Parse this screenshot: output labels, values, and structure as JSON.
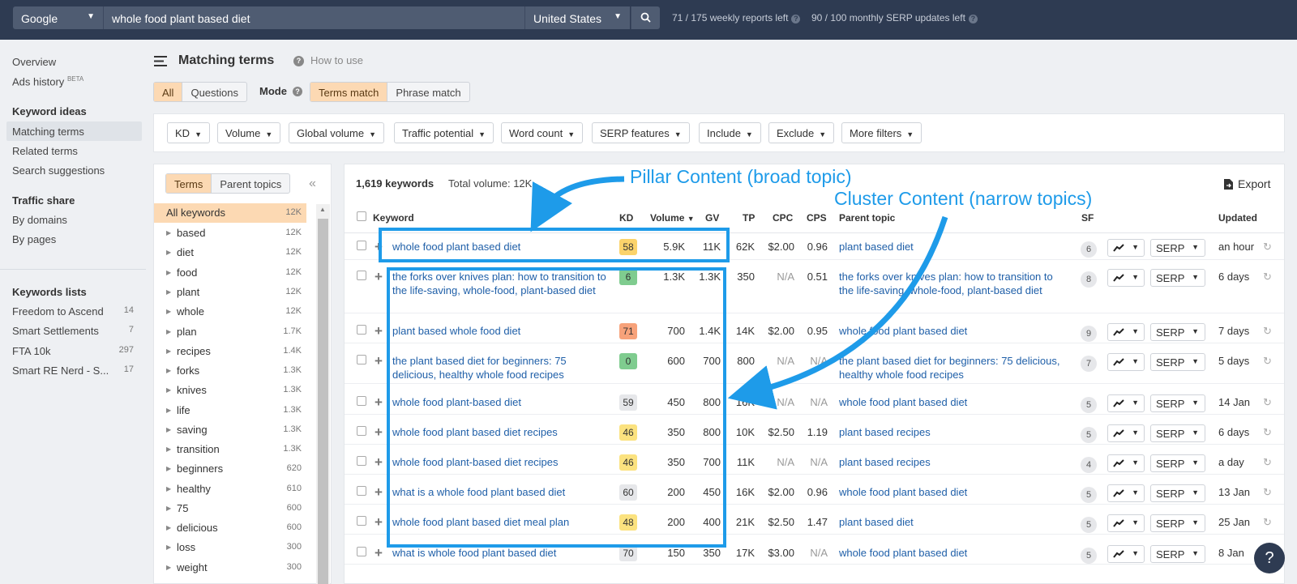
{
  "topbar": {
    "engine": "Google",
    "query": "whole food plant based diet",
    "country": "United States",
    "weekly": "71 / 175 weekly reports left",
    "monthly": "90 / 100 monthly SERP updates left"
  },
  "nav": {
    "overview": "Overview",
    "ads_history": "Ads history",
    "beta": "BETA",
    "keyword_ideas": "Keyword ideas",
    "matching_terms": "Matching terms",
    "related_terms": "Related terms",
    "search_suggestions": "Search suggestions",
    "traffic_share": "Traffic share",
    "by_domains": "By domains",
    "by_pages": "By pages",
    "lists_head": "Keywords lists",
    "lists": [
      {
        "name": "Freedom to Ascend",
        "count": "14"
      },
      {
        "name": "Smart Settlements",
        "count": "7"
      },
      {
        "name": "FTA 10k",
        "count": "297"
      },
      {
        "name": "Smart RE Nerd - S...",
        "count": "17"
      }
    ]
  },
  "header": {
    "title": "Matching terms",
    "how_to": "How to use",
    "all": "All",
    "questions": "Questions",
    "mode": "Mode",
    "terms_match": "Terms match",
    "phrase_match": "Phrase match"
  },
  "filters": [
    "KD",
    "Volume",
    "Global volume",
    "Traffic potential",
    "Word count",
    "SERP features",
    "Include",
    "Exclude",
    "More filters"
  ],
  "terms_panel": {
    "terms_tab": "Terms",
    "parent_tab": "Parent topics",
    "all_label": "All keywords",
    "all_count": "12K",
    "items": [
      {
        "label": "based",
        "count": "12K"
      },
      {
        "label": "diet",
        "count": "12K"
      },
      {
        "label": "food",
        "count": "12K"
      },
      {
        "label": "plant",
        "count": "12K"
      },
      {
        "label": "whole",
        "count": "12K"
      },
      {
        "label": "plan",
        "count": "1.7K"
      },
      {
        "label": "recipes",
        "count": "1.4K"
      },
      {
        "label": "forks",
        "count": "1.3K"
      },
      {
        "label": "knives",
        "count": "1.3K"
      },
      {
        "label": "life",
        "count": "1.3K"
      },
      {
        "label": "saving",
        "count": "1.3K"
      },
      {
        "label": "transition",
        "count": "1.3K"
      },
      {
        "label": "beginners",
        "count": "620"
      },
      {
        "label": "healthy",
        "count": "610"
      },
      {
        "label": "75",
        "count": "600"
      },
      {
        "label": "delicious",
        "count": "600"
      },
      {
        "label": "loss",
        "count": "300"
      },
      {
        "label": "weight",
        "count": "300"
      }
    ]
  },
  "results": {
    "count": "1,619 keywords",
    "total_volume": "Total volume: 12K",
    "export": "Export",
    "columns": {
      "keyword": "Keyword",
      "kd": "KD",
      "volume": "Volume",
      "gv": "GV",
      "tp": "TP",
      "cpc": "CPC",
      "cps": "CPS",
      "parent": "Parent topic",
      "sf": "SF",
      "updated": "Updated"
    },
    "serp_label": "SERP",
    "rows": [
      {
        "keyword": "whole food plant based diet",
        "kd": "58",
        "kd_color": "#fbd36b",
        "volume": "5.9K",
        "gv": "11K",
        "tp": "62K",
        "cpc": "$2.00",
        "cps": "0.96",
        "parent": "plant based diet",
        "sf": "6",
        "updated": "an hour"
      },
      {
        "keyword": "the forks over knives plan: how to transition to the life-saving, whole-food, plant-based diet",
        "kd": "6",
        "kd_color": "#7fcc8f",
        "volume": "1.3K",
        "gv": "1.3K",
        "tp": "350",
        "cpc": "N/A",
        "cps": "0.51",
        "parent": "the forks over knives plan: how to transition to the life-saving, whole-food, plant-based diet",
        "sf": "8",
        "updated": "6 days"
      },
      {
        "keyword": "plant based whole food diet",
        "kd": "71",
        "kd_color": "#f7a27a",
        "volume": "700",
        "gv": "1.4K",
        "tp": "14K",
        "cpc": "$2.00",
        "cps": "0.95",
        "parent": "whole food plant based diet",
        "sf": "9",
        "updated": "7 days"
      },
      {
        "keyword": "the plant based diet for beginners: 75 delicious, healthy whole food recipes",
        "kd": "0",
        "kd_color": "#7fcc8f",
        "volume": "600",
        "gv": "700",
        "tp": "800",
        "cpc": "N/A",
        "cps": "N/A",
        "parent": "the plant based diet for beginners: 75 delicious, healthy whole food recipes",
        "sf": "7",
        "updated": "5 days"
      },
      {
        "keyword": "whole food plant-based diet",
        "kd": "59",
        "kd_color": "#e6e7ea",
        "volume": "450",
        "gv": "800",
        "tp": "16K",
        "cpc": "N/A",
        "cps": "N/A",
        "parent": "whole food plant based diet",
        "sf": "5",
        "updated": "14 Jan"
      },
      {
        "keyword": "whole food plant based diet recipes",
        "kd": "46",
        "kd_color": "#fbe27f",
        "volume": "350",
        "gv": "800",
        "tp": "10K",
        "cpc": "$2.50",
        "cps": "1.19",
        "parent": "plant based recipes",
        "sf": "5",
        "updated": "6 days"
      },
      {
        "keyword": "whole food plant-based diet recipes",
        "kd": "46",
        "kd_color": "#fbe27f",
        "volume": "350",
        "gv": "700",
        "tp": "11K",
        "cpc": "N/A",
        "cps": "N/A",
        "parent": "plant based recipes",
        "sf": "4",
        "updated": "a day"
      },
      {
        "keyword": "what is a whole food plant based diet",
        "kd": "60",
        "kd_color": "#e6e7ea",
        "volume": "200",
        "gv": "450",
        "tp": "16K",
        "cpc": "$2.00",
        "cps": "0.96",
        "parent": "whole food plant based diet",
        "sf": "5",
        "updated": "13 Jan"
      },
      {
        "keyword": "whole food plant based diet meal plan",
        "kd": "48",
        "kd_color": "#fbe27f",
        "volume": "200",
        "gv": "400",
        "tp": "21K",
        "cpc": "$2.50",
        "cps": "1.47",
        "parent": "plant based diet",
        "sf": "5",
        "updated": "25 Jan"
      },
      {
        "keyword": "what is whole food plant based diet",
        "kd": "70",
        "kd_color": "#e6e7ea",
        "volume": "150",
        "gv": "350",
        "tp": "17K",
        "cpc": "$3.00",
        "cps": "N/A",
        "parent": "whole food plant based diet",
        "sf": "5",
        "updated": "8 Jan"
      }
    ]
  },
  "annotations": {
    "pillar": "Pillar Content (broad topic)",
    "cluster": "Cluster Content (narrow topics)",
    "color": "#1e9be9"
  },
  "help_fab": "?"
}
